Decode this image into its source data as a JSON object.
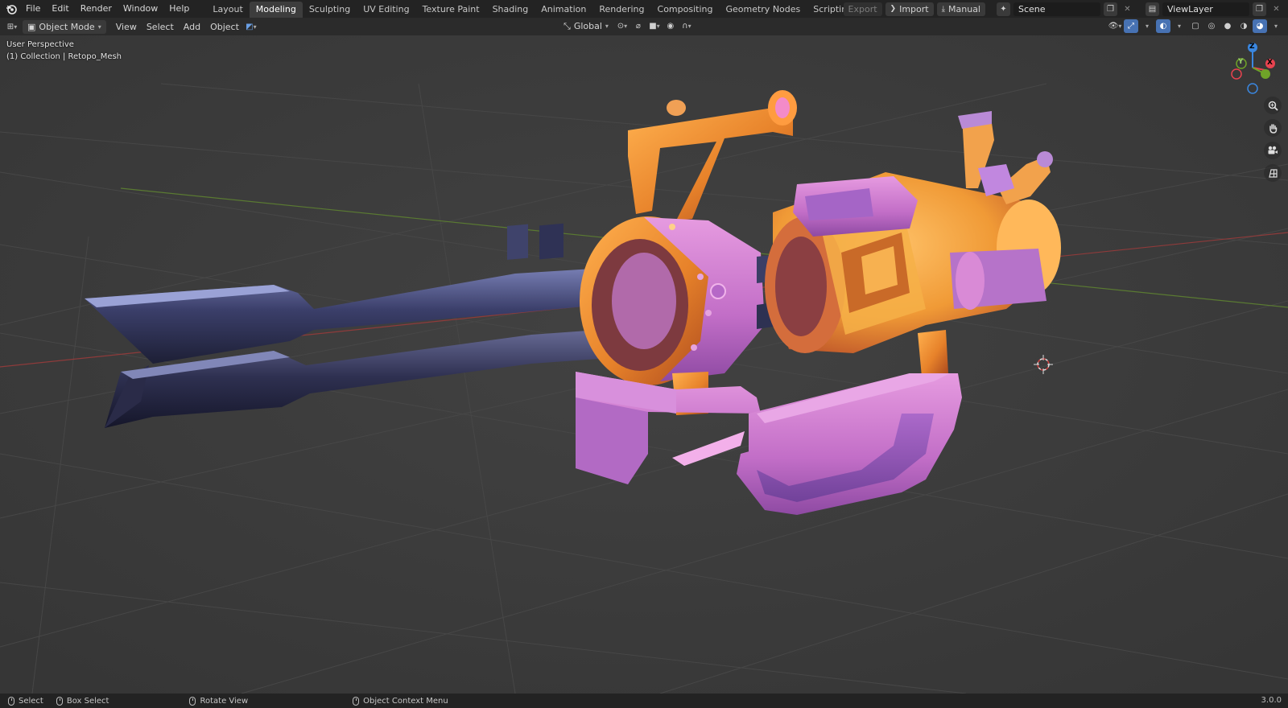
{
  "topbar": {
    "menus": [
      "File",
      "Edit",
      "Render",
      "Window",
      "Help"
    ],
    "workspaces": [
      "Layout",
      "Modeling",
      "Sculpting",
      "UV Editing",
      "Texture Paint",
      "Shading",
      "Animation",
      "Rendering",
      "Compositing",
      "Geometry Nodes",
      "Scripting"
    ],
    "active_workspace": "Modeling",
    "add_workspace": "+",
    "export_label": "Export",
    "import_label": "Import",
    "manual_label": "Manual",
    "scene_name": "Scene",
    "view_layer_name": "ViewLayer"
  },
  "header": {
    "mode": "Object Mode",
    "menus": [
      "View",
      "Select",
      "Add",
      "Object"
    ],
    "transform_orientation": "Global"
  },
  "viewport": {
    "perspective_label": "User Perspective",
    "collection_label": "(1) Collection | Retopo_Mesh",
    "gizmo": {
      "x": "X",
      "y": "Y",
      "z": "Z"
    }
  },
  "statusbar": {
    "select": "Select",
    "box_select": "Box Select",
    "rotate_view": "Rotate View",
    "context_menu": "Object Context Menu",
    "version": "3.0.0"
  },
  "colors": {
    "accent": "#4772b3",
    "axis_x": "#e8434f",
    "axis_y": "#6fa328",
    "axis_z": "#3a87e0",
    "viewport_bg": "#3d3d3d"
  },
  "icons": [
    "blender-logo-icon",
    "editor-type-icon",
    "object-mode-icon",
    "select-mode-icon",
    "orientation-icon",
    "pivot-icon",
    "snap-icon",
    "proportional-icon",
    "visibility-icon",
    "gizmo-icon",
    "overlay-icon",
    "xray-icon",
    "shading-wire-icon",
    "shading-solid-icon",
    "shading-material-icon",
    "shading-rendered-icon",
    "zoom-icon",
    "pan-hand-icon",
    "camera-icon",
    "grid-ortho-icon",
    "3d-cursor-icon"
  ]
}
